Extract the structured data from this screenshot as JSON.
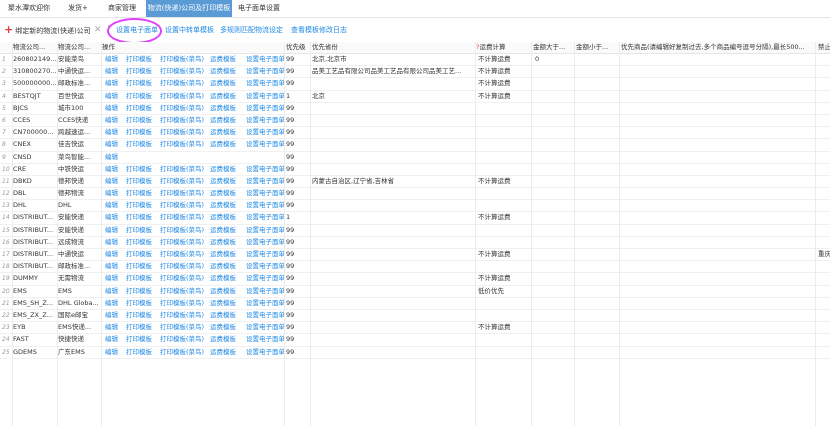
{
  "tabs": [
    "聚水潭欢迎你",
    "发货+",
    "商家管理",
    "物流(快递)公司及打印模板",
    "电子面单设置"
  ],
  "toolbar": {
    "bind_label": "绑定新的物流(快递)公司",
    "close_glyph": "✕",
    "set_eface": "设置电子面单",
    "set_relay": "设置中转单模板",
    "multi_match": "多规则匹配物流设定",
    "view_log": "查看模板修改日志"
  },
  "columns": [
    "物流公司...",
    "物流公司...",
    "操作",
    "优先级",
    "优先省份",
    "运费计算",
    "金额大于...",
    "金额小于...",
    "优先商品(请编辑好复制过去,多个商品编号逗号分隔),最长500...",
    "禁止"
  ],
  "column_required": "?",
  "ops": [
    "编辑",
    "打印模板",
    "打印模板(菜鸟)",
    "运费模板",
    "设置电子面单"
  ],
  "rows": [
    {
      "n": "1",
      "code": "260802149...",
      "name": "安能菜鸟",
      "pri": "99",
      "prov": "北京,北京市",
      "fee": "不计算运费",
      "gt": "0",
      "ops": true,
      "extra": ""
    },
    {
      "n": "2",
      "code": "310800270...",
      "name": "中通快运...",
      "pri": "99",
      "prov": "品美工艺品有限公司品美工艺品有限公司品美工艺...",
      "fee": "不计算运费",
      "gt": "",
      "ops": true,
      "extra": ""
    },
    {
      "n": "3",
      "code": "500000000...",
      "name": "邮政标准...",
      "pri": "99",
      "prov": "",
      "fee": "不计算运费",
      "gt": "",
      "ops": true,
      "extra": ""
    },
    {
      "n": "4",
      "code": "BESTQJT",
      "name": "百世快运",
      "pri": "1",
      "prov": "北京",
      "fee": "不计算运费",
      "gt": "",
      "ops": true,
      "extra": ""
    },
    {
      "n": "5",
      "code": "BJCS",
      "name": "城市100",
      "pri": "99",
      "prov": "",
      "fee": "",
      "gt": "",
      "ops": true,
      "extra": ""
    },
    {
      "n": "6",
      "code": "CCES",
      "name": "CCES快递",
      "pri": "99",
      "prov": "",
      "fee": "",
      "gt": "",
      "ops": true,
      "extra": ""
    },
    {
      "n": "7",
      "code": "CN700000...",
      "name": "跨越速运...",
      "pri": "99",
      "prov": "",
      "fee": "",
      "gt": "",
      "ops": true,
      "extra": ""
    },
    {
      "n": "8",
      "code": "CNEX",
      "name": "佳吉快运",
      "pri": "99",
      "prov": "",
      "fee": "",
      "gt": "",
      "ops": true,
      "extra": ""
    },
    {
      "n": "9",
      "code": "CNSD",
      "name": "菜鸟智能...",
      "pri": "99",
      "prov": "",
      "fee": "",
      "gt": "",
      "ops": "edit",
      "extra": ""
    },
    {
      "n": "10",
      "code": "CRE",
      "name": "中铁快运",
      "pri": "99",
      "prov": "",
      "fee": "",
      "gt": "",
      "ops": true,
      "extra": ""
    },
    {
      "n": "11",
      "code": "DBKD",
      "name": "德邦快递",
      "pri": "99",
      "prov": "内蒙古自治区,辽宁省,吉林省",
      "fee": "不计算运费",
      "gt": "",
      "ops": true,
      "extra": ""
    },
    {
      "n": "12",
      "code": "DBL",
      "name": "德邦物流",
      "pri": "99",
      "prov": "",
      "fee": "",
      "gt": "",
      "ops": true,
      "extra": ""
    },
    {
      "n": "13",
      "code": "DHL",
      "name": "DHL",
      "pri": "99",
      "prov": "",
      "fee": "",
      "gt": "",
      "ops": true,
      "extra": ""
    },
    {
      "n": "14",
      "code": "DISTRIBUT...",
      "name": "安能快递",
      "pri": "1",
      "prov": "",
      "fee": "不计算运费",
      "gt": "",
      "ops": true,
      "extra": ""
    },
    {
      "n": "15",
      "code": "DISTRIBUT...",
      "name": "安能快递",
      "pri": "99",
      "prov": "",
      "fee": "",
      "gt": "",
      "ops": true,
      "extra": ""
    },
    {
      "n": "16",
      "code": "DISTRIBUT...",
      "name": "远成物流",
      "pri": "99",
      "prov": "",
      "fee": "",
      "gt": "",
      "ops": true,
      "extra": ""
    },
    {
      "n": "17",
      "code": "DISTRIBUT...",
      "name": "中通快运",
      "pri": "99",
      "prov": "",
      "fee": "不计算运费",
      "gt": "",
      "ops": true,
      "extra": "重庆"
    },
    {
      "n": "18",
      "code": "DISTRIBUT...",
      "name": "邮政标准...",
      "pri": "99",
      "prov": "",
      "fee": "",
      "gt": "",
      "ops": true,
      "extra": ""
    },
    {
      "n": "19",
      "code": "DUMMY",
      "name": "无需物流",
      "pri": "99",
      "prov": "",
      "fee": "不计算运费",
      "gt": "",
      "ops": true,
      "extra": ""
    },
    {
      "n": "20",
      "code": "EMS",
      "name": "EMS",
      "pri": "99",
      "prov": "",
      "fee": "低价优先",
      "gt": "",
      "ops": true,
      "extra": ""
    },
    {
      "n": "21",
      "code": "EMS_SH_Z...",
      "name": "DHL Globa...",
      "pri": "99",
      "prov": "",
      "fee": "",
      "gt": "",
      "ops": true,
      "extra": ""
    },
    {
      "n": "22",
      "code": "EMS_ZX_Z...",
      "name": "国际e邮宝",
      "pri": "99",
      "prov": "",
      "fee": "",
      "gt": "",
      "ops": true,
      "extra": ""
    },
    {
      "n": "23",
      "code": "EYB",
      "name": "EMS快递...",
      "pri": "99",
      "prov": "",
      "fee": "不计算运费",
      "gt": "",
      "ops": true,
      "extra": ""
    },
    {
      "n": "24",
      "code": "FAST",
      "name": "快捷快递",
      "pri": "99",
      "prov": "",
      "fee": "",
      "gt": "",
      "ops": true,
      "extra": ""
    },
    {
      "n": "25",
      "code": "GDEMS",
      "name": "广东EMS",
      "pri": "99",
      "prov": "",
      "fee": "",
      "gt": "",
      "ops": true,
      "extra": ""
    }
  ],
  "colors": {
    "active_tab": "#5b9bd5",
    "link": "#1e88e5",
    "highlight": "#e040fb",
    "add_icon": "#e53935"
  }
}
